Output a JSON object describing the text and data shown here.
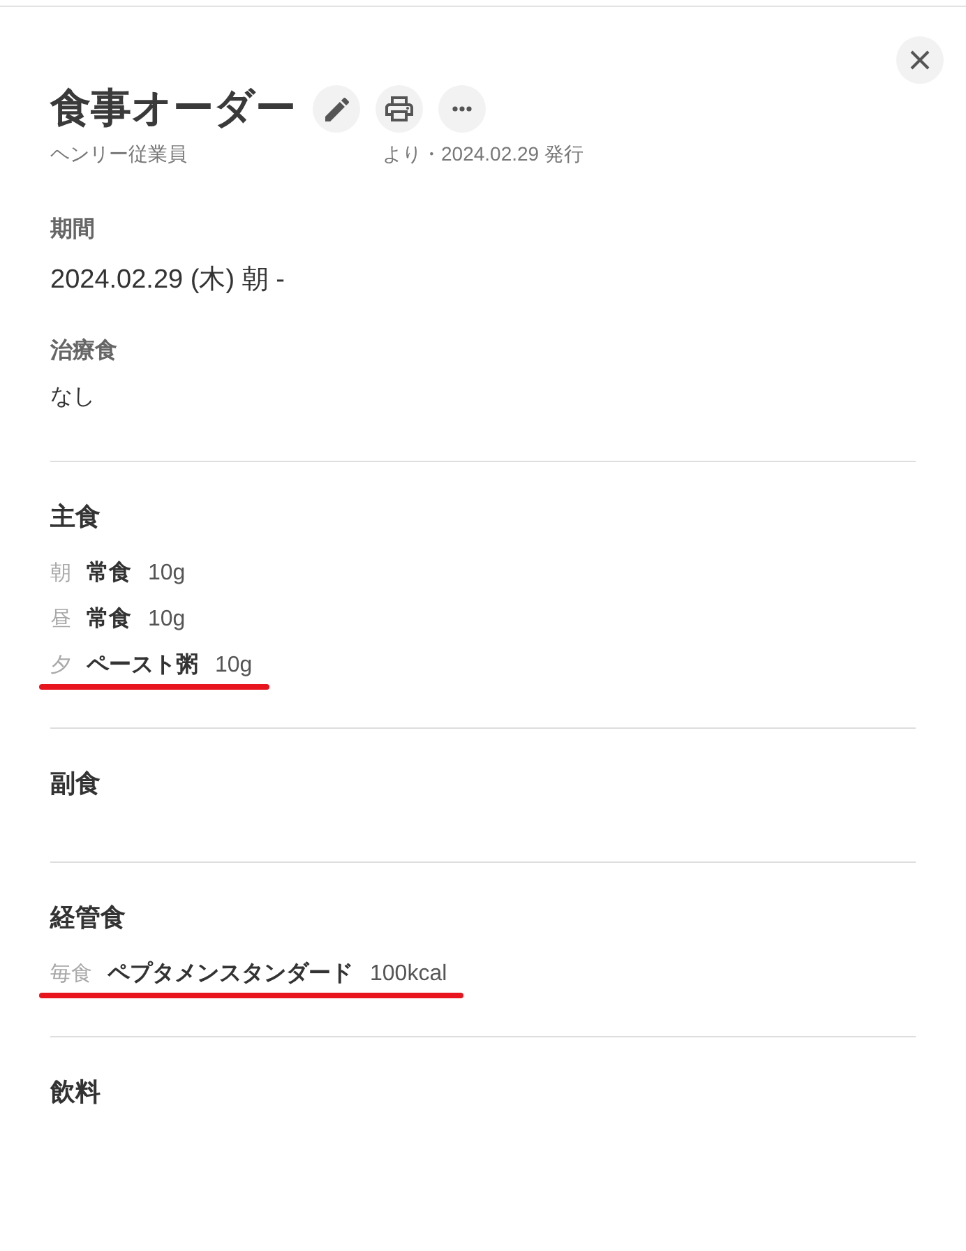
{
  "title": "食事オーダー",
  "actions": [
    {
      "kind": "edit"
    },
    {
      "kind": "print"
    },
    {
      "kind": "more"
    }
  ],
  "meta": {
    "author": "ヘンリー従業員",
    "issued": "より・2024.02.29 発行"
  },
  "period": {
    "label": "期間",
    "value": "2024.02.29 (木) 朝 -"
  },
  "therapeutic_diet": {
    "label": "治療食",
    "value": "なし"
  },
  "sections": [
    {
      "title": "主食",
      "items": [
        {
          "timing": "朝",
          "name": "常食",
          "amount": "10g",
          "underlined": false
        },
        {
          "timing": "昼",
          "name": "常食",
          "amount": "10g",
          "underlined": false
        },
        {
          "timing": "夕",
          "name": "ペースト粥",
          "amount": "10g",
          "underlined": true
        }
      ]
    },
    {
      "title": "副食"
    },
    {
      "title": "経管食",
      "items": [
        {
          "timing": "毎食",
          "name": "ペプタメンスタンダード",
          "amount": "100kcal",
          "underlined": true
        }
      ]
    },
    {
      "title": "飲料"
    }
  ]
}
